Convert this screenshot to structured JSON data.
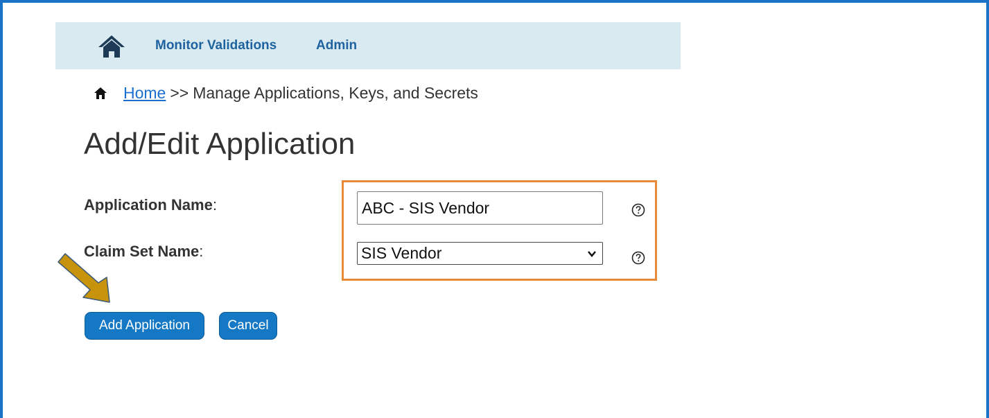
{
  "nav": {
    "home_icon": "home-icon",
    "items": [
      {
        "label": "Monitor Validations"
      },
      {
        "label": "Admin"
      }
    ]
  },
  "breadcrumb": {
    "icon": "home-icon",
    "home_label": "Home",
    "separator": ">>",
    "current": "Manage Applications, Keys, and Secrets"
  },
  "page": {
    "title": "Add/Edit Application"
  },
  "form": {
    "application_name": {
      "label": "Application Name",
      "label_suffix": ":",
      "value": "ABC - SIS Vendor"
    },
    "claim_set_name": {
      "label": "Claim Set Name",
      "label_suffix": ":",
      "selected": "SIS Vendor"
    }
  },
  "buttons": {
    "add_label": "Add Application",
    "cancel_label": "Cancel"
  },
  "colors": {
    "frame_border": "#1a73c4",
    "nav_background": "#d9eaf1",
    "nav_link": "#1f62a0",
    "link": "#1a6fd1",
    "button": "#1478c4",
    "highlight": "#e98a38",
    "arrow": "#c6930a"
  }
}
